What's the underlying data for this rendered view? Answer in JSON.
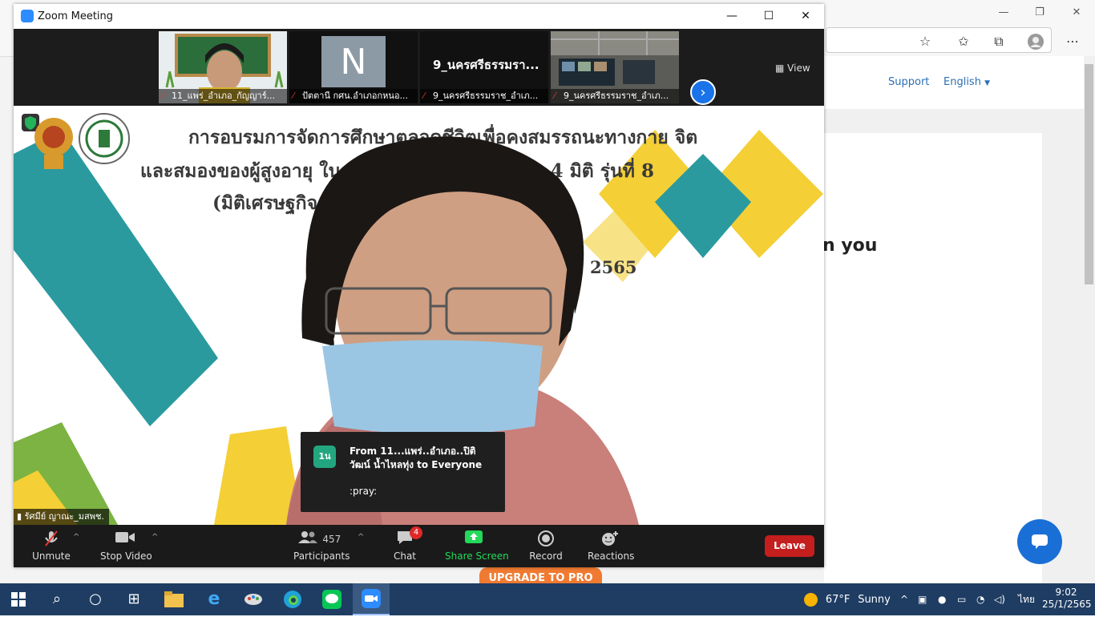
{
  "browser": {
    "support_label": "Support",
    "language_label": "English",
    "headline_fragment": "n you",
    "upgrade_label": "UPGRADE TO PRO"
  },
  "zoom": {
    "window_title": "Zoom Meeting",
    "view_label": "View",
    "thumbnails": [
      {
        "label": "11_แพร่_อำเภอ_กัญญาร์...",
        "content": ""
      },
      {
        "label": "ปัตตานี กศน.อำเภอกหนอ...",
        "content": "N"
      },
      {
        "label": "9_นครศรีธรรมราช_อำเภ...",
        "content": "9_นครศรีธรรมรา..."
      },
      {
        "label": "9_นครศรีธรรมราช_อำเภ...",
        "content": ""
      }
    ],
    "slide": {
      "line1": "การอบรมการจัดการศึกษาตลอดชีวิตเพื่อคงสมรรถนะทางกาย จิต",
      "line2": "และสมองของผู้สูงอายุ ใน          กรรมพัฒนาทักษะชีวิตใน 4 มิติ  รุ่นที่ 8",
      "line3": "(มิติเศรษฐกิจ                   ภาพแวดล้อม  และมิติสังคม)",
      "line4": "าคม 2565"
    },
    "speaker_name": "รัศมีย์ ญาณะ_มสพช.",
    "chat_popup": {
      "avatar": "1น",
      "from": "From 11...แพร่..อำเภอ..ปิติวัฒน์ น้ำไหลทุ่ง to Everyone",
      "message": ":pray:"
    },
    "toolbar": {
      "unmute": "Unmute",
      "stop_video": "Stop Video",
      "participants": "Participants",
      "participants_count": "457",
      "chat": "Chat",
      "chat_badge": "4",
      "share_screen": "Share Screen",
      "record": "Record",
      "reactions": "Reactions",
      "leave": "Leave"
    },
    "colors": {
      "share_green": "#23d959",
      "leave_red": "#c41e1e",
      "teal_stripe": "#2a9a9f",
      "yellow": "#f4cf35"
    }
  },
  "taskbar": {
    "weather_temp": "67°F",
    "weather_text": "Sunny",
    "language": "ไทย",
    "time": "9:02",
    "date": "25/1/2565"
  }
}
